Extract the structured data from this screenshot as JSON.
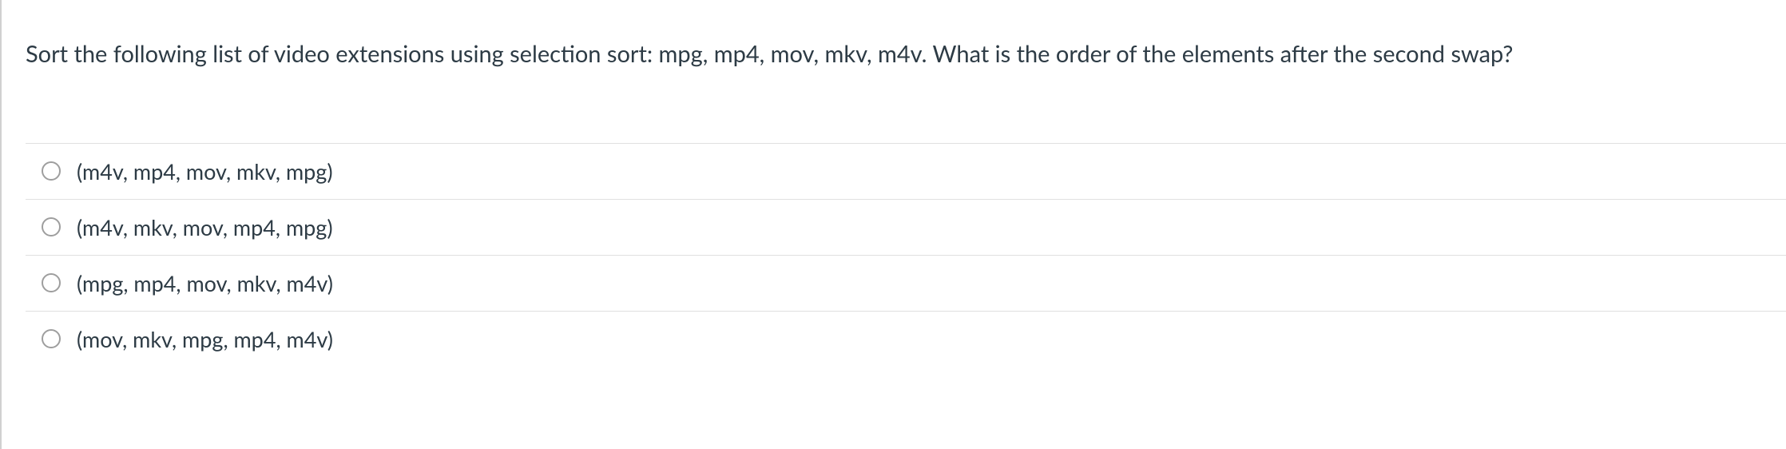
{
  "question": {
    "text": "Sort the following list of video extensions using selection sort: mpg, mp4, mov, mkv, m4v. What is the order of the elements after the second swap?"
  },
  "options": [
    {
      "label": "(m4v, mp4, mov, mkv, mpg)"
    },
    {
      "label": "(m4v, mkv, mov, mp4, mpg)"
    },
    {
      "label": "(mpg, mp4, mov, mkv, m4v)"
    },
    {
      "label": "(mov, mkv, mpg, mp4, m4v)"
    }
  ]
}
